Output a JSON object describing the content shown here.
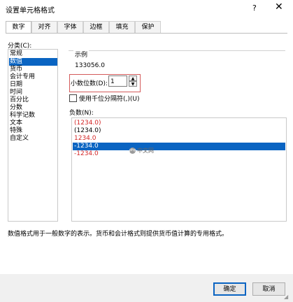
{
  "window": {
    "title": "设置单元格格式",
    "help_glyph": "?",
    "close_glyph": "✕"
  },
  "tabs": [
    {
      "label": "数字",
      "active": true
    },
    {
      "label": "对齐",
      "active": false
    },
    {
      "label": "字体",
      "active": false
    },
    {
      "label": "边框",
      "active": false
    },
    {
      "label": "填充",
      "active": false
    },
    {
      "label": "保护",
      "active": false
    }
  ],
  "category": {
    "label": "分类(C):",
    "items": [
      "常规",
      "数值",
      "货币",
      "会计专用",
      "日期",
      "时间",
      "百分比",
      "分数",
      "科学记数",
      "文本",
      "特殊",
      "自定义"
    ],
    "selected": "数值"
  },
  "sample": {
    "label": "示例",
    "value": "133056.0"
  },
  "decimal": {
    "label": "小数位数(D):",
    "value": "1"
  },
  "separator": {
    "label": "使用千位分隔符(,)(U)",
    "checked": false
  },
  "negative": {
    "label": "负数(N):",
    "items": [
      {
        "text": "(1234.0)",
        "color": "#d32626",
        "selected": false
      },
      {
        "text": "(1234.0)",
        "color": "#000000",
        "selected": false
      },
      {
        "text": "1234.0",
        "color": "#d32626",
        "selected": false
      },
      {
        "text": "-1234.0",
        "color": "#ffffff",
        "selected": true
      },
      {
        "text": "-1234.0",
        "color": "#d32626",
        "selected": false
      }
    ]
  },
  "watermark": {
    "badge": "php",
    "text": "中文网"
  },
  "description": "数值格式用于一般数字的表示。货币和会计格式则提供货币值计算的专用格式。",
  "buttons": {
    "ok": "确定",
    "cancel": "取消"
  },
  "colors": {
    "selection": "#0a64c2",
    "negative_red": "#d32626",
    "highlight_border": "#d45a5a"
  }
}
